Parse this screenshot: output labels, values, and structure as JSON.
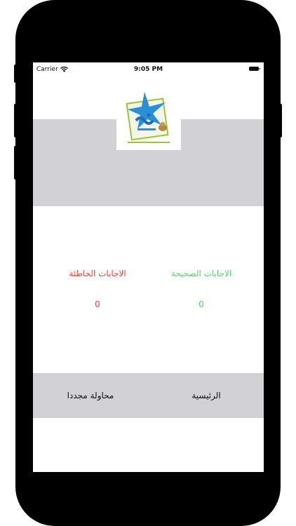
{
  "status_bar": {
    "carrier": "Carrier",
    "time": "9:05 PM"
  },
  "logo": {
    "name": "nahw-logo"
  },
  "results": {
    "correct_label": "الاجابات الصحيحة",
    "correct_value": "0",
    "wrong_label": "الاجابات الخاطئة",
    "wrong_value": "0"
  },
  "footer": {
    "home_label": "الرئيسية",
    "retry_label": "محاولة مجددا"
  },
  "colors": {
    "correct": "#4cd964",
    "wrong": "#ff3b30",
    "band": "#d1d1d6"
  }
}
